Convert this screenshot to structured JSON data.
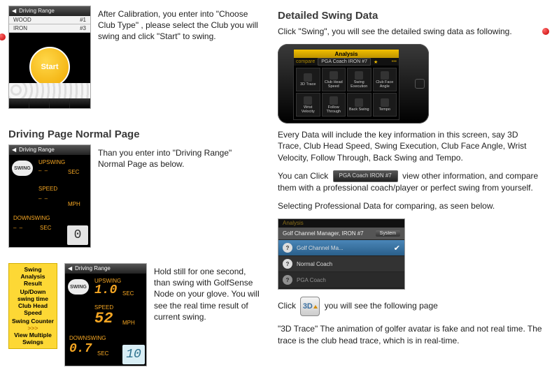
{
  "left": {
    "intro_para": "After Calibration, you enter into \"Choose Club Type\" , please select the Club you will swing and click \"Start\" to swing.",
    "screenshot1": {
      "title": "Driving Range",
      "rows": [
        {
          "club": "WOOD",
          "num": "#1"
        },
        {
          "club": "IRON",
          "num": "#3"
        }
      ],
      "start_label": "Start"
    },
    "heading_normal": "Driving Page Normal Page",
    "normal_para": "Than you enter into \"Driving Range\" Normal Page as below.",
    "screenshot2": {
      "title": "Driving Range",
      "badge": "SWING",
      "upswing_label": "UPSWING",
      "sec_unit": "SEC",
      "speed_label": "SPEED",
      "mph_unit": "MPH",
      "downswing_label": "DOWNSWING",
      "downswing_unit": "SEC",
      "count": "0"
    },
    "hold_para": "Hold still for one second, than swing with GolfSense Node on your glove. You will see the real time result of current swing.",
    "yellow_panel": {
      "l1": "Swing Analysis Result",
      "l2": "Up/Down swing time Club Head Speed",
      "l3": "Swing Counter",
      "arrow": ">>>",
      "l4": "View Multiple Swings"
    },
    "screenshot3": {
      "title": "Driving Range",
      "badge": "SWING",
      "upswing_label": "UPSWING",
      "up_val": "1.0",
      "up_unit": "SEC",
      "speed_label": "SPEED",
      "speed_val": "52",
      "speed_unit": "MPH",
      "downswing_label": "DOWNSWING",
      "down_val": "0.7",
      "down_unit": "SEC",
      "count": "10"
    }
  },
  "right": {
    "heading": "Detailed Swing Data",
    "para1": "Click \"Swing\", you will see the detailed swing data as following.",
    "analysis": {
      "title": "Analysis",
      "compare_chip": "PGA Coach IRON #7",
      "cells": [
        "3D Trace",
        "Club Head Speed",
        "Swing Execution",
        "Club Face Angle",
        "Wrist Velocity",
        "Follow Through",
        "Back Swing",
        "Tempo"
      ]
    },
    "para2": "Every Data will include the key information in this screen, say 3D Trace, Club Head Speed, Swing Execution, Club Face Angle, Wrist Velocity, Follow Through, Back Swing and Tempo.",
    "para3_a": "You can Click",
    "para3_btn": "PGA Coach IRON #7",
    "para3_b": "view other information, and compare them with a professional coach/player or perfect swing from yourself.",
    "para4": "Selecting Professional Data for comparing, as seen below.",
    "prolist": {
      "heading": "Analysis",
      "row0": "Golf Channel Manager, IRON #7",
      "row0_tag": "System",
      "row1": "Golf Channel Ma...",
      "row2": "Normal Coach",
      "row3": "PGA Coach"
    },
    "para5_a": "Click",
    "icon3d": "3D",
    "para5_b": "you will see the following page",
    "para6": " \"3D Trace\" The animation of golfer avatar is fake and not real time. The trace is the club head trace, which is in real-time."
  }
}
